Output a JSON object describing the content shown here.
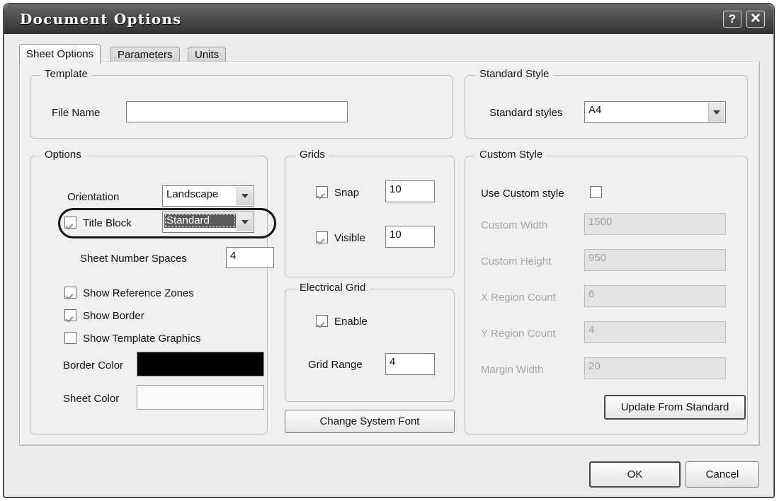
{
  "window": {
    "title": "Document Options",
    "help_button": "?",
    "close_button": "✕"
  },
  "tabs": [
    {
      "label": "Sheet Options",
      "active": true
    },
    {
      "label": "Parameters",
      "active": false
    },
    {
      "label": "Units",
      "active": false
    }
  ],
  "template_group": {
    "legend": "Template",
    "file_name_label": "File Name",
    "file_name_value": ""
  },
  "options_group": {
    "legend": "Options",
    "orientation_label": "Orientation",
    "orientation_value": "Landscape",
    "title_block_label": "Title Block",
    "title_block_checked": true,
    "title_block_value": "Standard",
    "sheet_number_spaces_label": "Sheet Number Spaces",
    "sheet_number_spaces_value": "4",
    "show_reference_zones_label": "Show Reference Zones",
    "show_reference_zones_checked": true,
    "show_border_label": "Show Border",
    "show_border_checked": true,
    "show_template_graphics_label": "Show Template Graphics",
    "show_template_graphics_checked": false,
    "border_color_label": "Border Color",
    "border_color_value": "#000000",
    "sheet_color_label": "Sheet Color",
    "sheet_color_value": "#fbfbfb"
  },
  "grids_group": {
    "legend": "Grids",
    "snap_label": "Snap",
    "snap_checked": true,
    "snap_value": "10",
    "visible_label": "Visible",
    "visible_checked": true,
    "visible_value": "10"
  },
  "electrical_grid_group": {
    "legend": "Electrical Grid",
    "enable_label": "Enable",
    "enable_checked": true,
    "grid_range_label": "Grid Range",
    "grid_range_value": "4"
  },
  "change_system_font_button": "Change System Font",
  "standard_style_group": {
    "legend": "Standard Style",
    "standard_styles_label": "Standard styles",
    "standard_styles_value": "A4"
  },
  "custom_style_group": {
    "legend": "Custom Style",
    "use_custom_style_label": "Use Custom style",
    "use_custom_style_checked": false,
    "custom_width_label": "Custom Width",
    "custom_width_value": "1500",
    "custom_height_label": "Custom Height",
    "custom_height_value": "950",
    "x_region_count_label": "X Region Count",
    "x_region_count_value": "6",
    "y_region_count_label": "Y Region Count",
    "y_region_count_value": "4",
    "margin_width_label": "Margin Width",
    "margin_width_value": "20",
    "update_from_standard_button": "Update From Standard"
  },
  "footer": {
    "ok_button": "OK",
    "cancel_button": "Cancel"
  }
}
